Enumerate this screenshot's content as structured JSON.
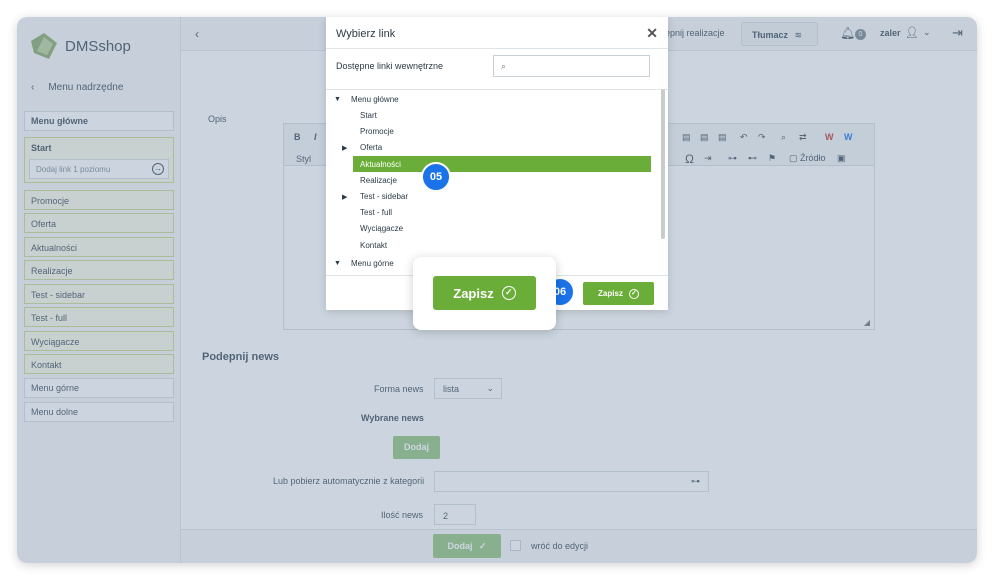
{
  "app": {
    "logo_text": "DMSshop"
  },
  "sidebar": {
    "back_label": "Menu nadrzędne",
    "main_menu": "Menu główne",
    "start_label": "Start",
    "add_link_label": "Dodaj link 1 poziomu",
    "items": [
      "Promocje",
      "Oferta",
      "Aktualności",
      "Realizacje",
      "Test - sidebar",
      "Test - full",
      "Wyciągacze",
      "Kontakt"
    ],
    "top_menu": "Menu górne",
    "bottom_menu": "Menu dolne"
  },
  "topbar": {
    "partial_text": "epnij realizacje",
    "translate_label": "Tłumacz",
    "notification_count": "0",
    "user_name": "zaler"
  },
  "main": {
    "opis_label": "Opis",
    "editor": {
      "style_label": "Styl",
      "source_label": "Źródło"
    },
    "section_title": "Podepnij news",
    "forma_news_label": "Forma news",
    "forma_news_value": "lista",
    "wybrane_news_label": "Wybrane news",
    "dodaj_label": "Dodaj",
    "kategorie_label": "Lub pobierz automatycznie z kategorii",
    "ilosc_label": "Ilość news",
    "ilosc_value": "2",
    "bottom_dodaj": "Dodaj",
    "wroc_label": "wróć do edycji"
  },
  "modal": {
    "title": "Wybierz link",
    "subtitle": "Dostępne linki wewnętrzne",
    "tree": [
      {
        "label": "Menu główne",
        "level": 0,
        "arrow": "down"
      },
      {
        "label": "Start",
        "level": 1,
        "arrow": ""
      },
      {
        "label": "Promocje",
        "level": 1,
        "arrow": ""
      },
      {
        "label": "Oferta",
        "level": 1,
        "arrow": "right"
      },
      {
        "label": "Aktualności",
        "level": 1,
        "arrow": "",
        "selected": true
      },
      {
        "label": "Realizacje",
        "level": 1,
        "arrow": ""
      },
      {
        "label": "Test - sidebar",
        "level": 1,
        "arrow": "right"
      },
      {
        "label": "Test - full",
        "level": 1,
        "arrow": ""
      },
      {
        "label": "Wyciągacze",
        "level": 1,
        "arrow": ""
      },
      {
        "label": "Kontakt",
        "level": 1,
        "arrow": ""
      },
      {
        "label": "Menu górne",
        "level": 0,
        "arrow": "down"
      }
    ],
    "save_label": "Zapisz"
  },
  "callout": {
    "save_label": "Zapisz"
  },
  "badges": {
    "step5": "05",
    "step6": "06"
  },
  "colors": {
    "accent_green": "#6aad38",
    "badge_blue": "#1a73e8"
  }
}
